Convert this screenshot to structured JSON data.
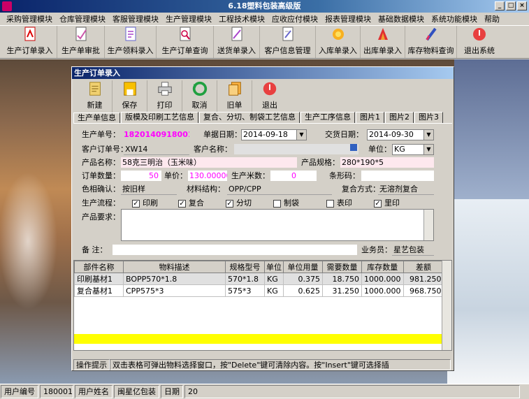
{
  "app": {
    "title": "6.18塑料包装高级版"
  },
  "menu": [
    "采购管理模块",
    "仓库管理模块",
    "客服管理模块",
    "生产管理模块",
    "工程技术模块",
    "应收应付模块",
    "报表管理模块",
    "基础数据模块",
    "系统功能模块",
    "帮助"
  ],
  "toolbar": [
    {
      "label": "生产订单录入",
      "icon": "document-pdf-icon"
    },
    {
      "label": "生产单审批",
      "icon": "approve-icon"
    },
    {
      "label": "生产领料录入",
      "icon": "material-icon"
    },
    {
      "label": "生产订单查询",
      "icon": "search-doc-icon"
    },
    {
      "label": "送货单录入",
      "icon": "delivery-icon"
    },
    {
      "label": "客户信息管理",
      "icon": "customer-icon"
    },
    {
      "label": "入库单录入",
      "icon": "stock-in-icon"
    },
    {
      "label": "出库单录入",
      "icon": "stock-out-icon"
    },
    {
      "label": "库存物料查询",
      "icon": "inventory-icon"
    },
    {
      "label": "退出系统",
      "icon": "exit-icon"
    }
  ],
  "dialog": {
    "title": "生产订单录入",
    "buttons": [
      "新建",
      "保存",
      "打印",
      "取消",
      "旧单",
      "退出"
    ],
    "tabs": [
      "生产单信息",
      "版模及印刷工艺信息",
      "复合、分切、制袋工艺信息",
      "生产工序信息",
      "图片1",
      "图片2",
      "图片3"
    ],
    "form": {
      "order_no_label": "生产单号：",
      "order_no": "1820140918001",
      "doc_date_label": "单据日期：",
      "doc_date": "2014-09-18",
      "delivery_date_label": "交货日期：",
      "delivery_date": "2014-09-30",
      "customer_order_label": "客户订单号：",
      "customer_order": "XW14",
      "customer_name_label": "客户名称：",
      "customer_name": "",
      "unit_label": "单位：",
      "unit": "KG",
      "product_name_label": "产品名称：",
      "product_name": "58克三明治（玉米味）",
      "product_spec_label": "产品规格：",
      "product_spec": "280*190*5",
      "qty_label": "订单数量：",
      "qty": "50",
      "price_label": "单价：",
      "price": "130.00000",
      "meters_label": "生产米数：",
      "meters": "0",
      "barcode_label": "条形码：",
      "barcode": "",
      "color_label": "色相确认：",
      "color": "按旧样",
      "material_label": "材料结构：",
      "material": "OPP/CPP",
      "compound_label": "复合方式：",
      "compound": "无溶剂复合",
      "process_label": "生产流程：",
      "process": [
        {
          "label": "印刷",
          "checked": true
        },
        {
          "label": "复合",
          "checked": true
        },
        {
          "label": "分切",
          "checked": true
        },
        {
          "label": "制袋",
          "checked": false
        },
        {
          "label": "表印",
          "checked": false
        },
        {
          "label": "里印",
          "checked": true
        }
      ],
      "requirement_label": "产品要求：",
      "remark_label": "备  注：",
      "salesman_label": "业务员：",
      "salesman": "星艺包装"
    },
    "grid": {
      "headers": [
        "部件名称",
        "物料描述",
        "规格型号",
        "单位",
        "单位用量",
        "需要数量",
        "库存数量",
        "差额"
      ],
      "rows": [
        [
          "印刷基材1",
          "BOPP570*1.8",
          "570*1.8",
          "KG",
          "0.375",
          "18.750",
          "1000.000",
          "981.250"
        ],
        [
          "复合基材1",
          "CPP575*3",
          "575*3",
          "KG",
          "0.625",
          "31.250",
          "1000.000",
          "968.750"
        ]
      ]
    },
    "hint_label": "操作提示",
    "hint": "双击表格可弹出物料选择窗口，按\"Delete\"键可清除内容。按\"Insert\"键可选择插"
  },
  "status": {
    "user_no_label": "用户编号",
    "user_no": "180001",
    "user_name_label": "用户姓名",
    "user_name": "闽星亿包装",
    "date_label": "日期",
    "date": "20"
  }
}
